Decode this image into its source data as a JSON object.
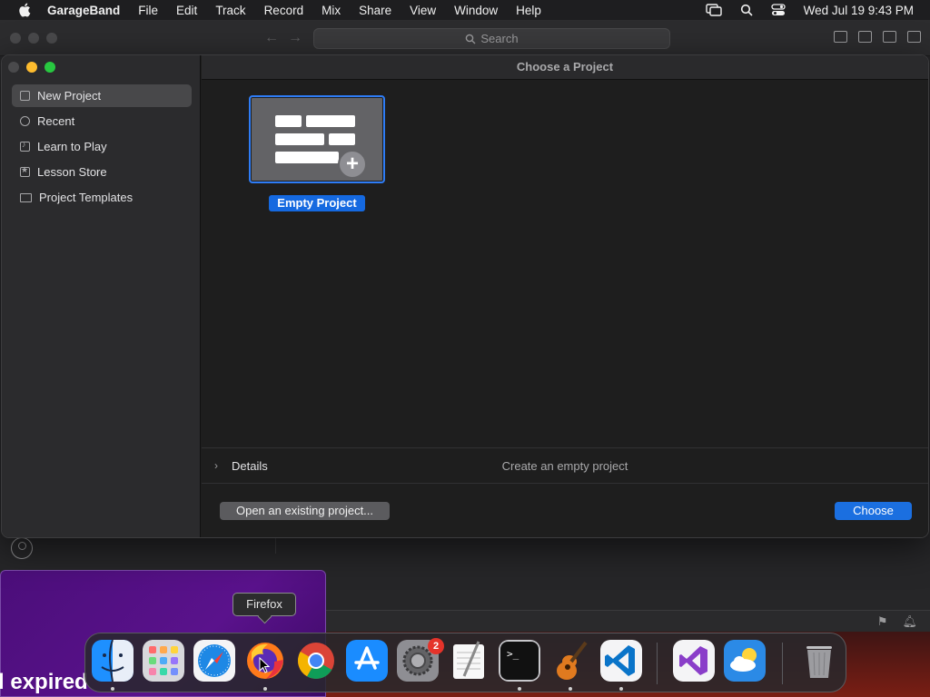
{
  "menubar": {
    "app_name": "GarageBand",
    "items": [
      "File",
      "Edit",
      "Track",
      "Record",
      "Mix",
      "Share",
      "View",
      "Window",
      "Help"
    ],
    "clock": "Wed Jul 19  9:43 PM"
  },
  "background_window": {
    "search_placeholder": "Search"
  },
  "background": {
    "partial_text": "l expired"
  },
  "chooser": {
    "title": "Choose a Project",
    "sidebar": [
      {
        "label": "New Project",
        "icon": "document-icon",
        "selected": true
      },
      {
        "label": "Recent",
        "icon": "clock-icon",
        "selected": false
      },
      {
        "label": "Learn to Play",
        "icon": "music-note-icon",
        "selected": false
      },
      {
        "label": "Lesson Store",
        "icon": "star-icon",
        "selected": false
      },
      {
        "label": "Project Templates",
        "icon": "folder-icon",
        "selected": false
      }
    ],
    "tile": {
      "label": "Empty Project"
    },
    "details": {
      "label": "Details",
      "description": "Create an empty project"
    },
    "open_button": "Open an existing project...",
    "choose_button": "Choose"
  },
  "tooltip": {
    "text": "Firefox"
  },
  "dock": {
    "apps": [
      {
        "name": "Finder",
        "running": true
      },
      {
        "name": "Launchpad",
        "running": false
      },
      {
        "name": "Safari",
        "running": false
      },
      {
        "name": "Firefox",
        "running": true
      },
      {
        "name": "Google Chrome",
        "running": false
      },
      {
        "name": "App Store",
        "running": false
      },
      {
        "name": "System Settings",
        "running": false,
        "badge": "2"
      },
      {
        "name": "TextEdit",
        "running": false
      },
      {
        "name": "Terminal",
        "running": true
      },
      {
        "name": "GarageBand",
        "running": true
      },
      {
        "name": "Visual Studio Code",
        "running": true
      },
      {
        "name": "Visual Studio",
        "running": false
      },
      {
        "name": "Weather",
        "running": false
      },
      {
        "name": "Trash",
        "running": false
      }
    ]
  },
  "colors": {
    "accent": "#1b6fe0",
    "selection_border": "#2e7cf6",
    "badge": "#e5332a",
    "traffic_red": "#fe5f57",
    "traffic_yellow": "#febc2e",
    "traffic_green": "#28c840"
  }
}
